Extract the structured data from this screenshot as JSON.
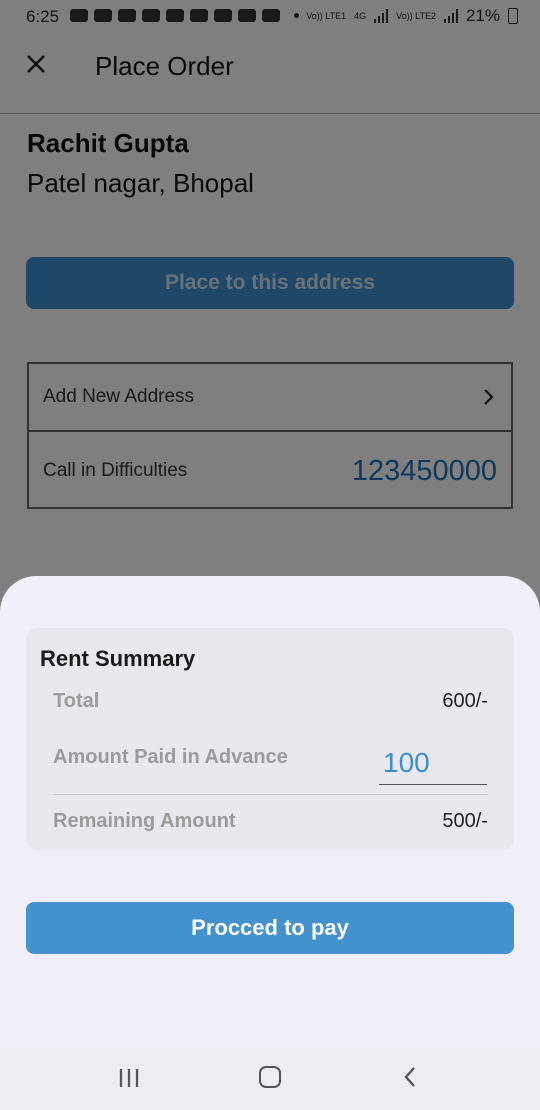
{
  "status_bar": {
    "time": "6:25",
    "network1": "Vo)) LTE1",
    "network2": "4G",
    "network3": "Vo)) LTE2",
    "battery": "21%"
  },
  "app_bar": {
    "title": "Place Order",
    "close_icon": "close-icon"
  },
  "address": {
    "name": "Rachit Gupta",
    "location": "Patel nagar, Bhopal"
  },
  "place_button": {
    "label": "Place to this address"
  },
  "options": {
    "add_address": "Add New Address",
    "call_label": "Call in Difficulties",
    "phone": "123450000"
  },
  "sheet": {
    "summary_title": "Rent Summary",
    "total_label": "Total",
    "total_value": "600/-",
    "advance_label": "Amount Paid in Advance",
    "advance_value": "100",
    "remaining_label": "Remaining Amount",
    "remaining_value": "500/-",
    "pay_button": "Procced to pay"
  },
  "colors": {
    "accent": "#4391cd",
    "sheet_bg": "#f3eff8",
    "card_bg": "#ebe7ef"
  }
}
